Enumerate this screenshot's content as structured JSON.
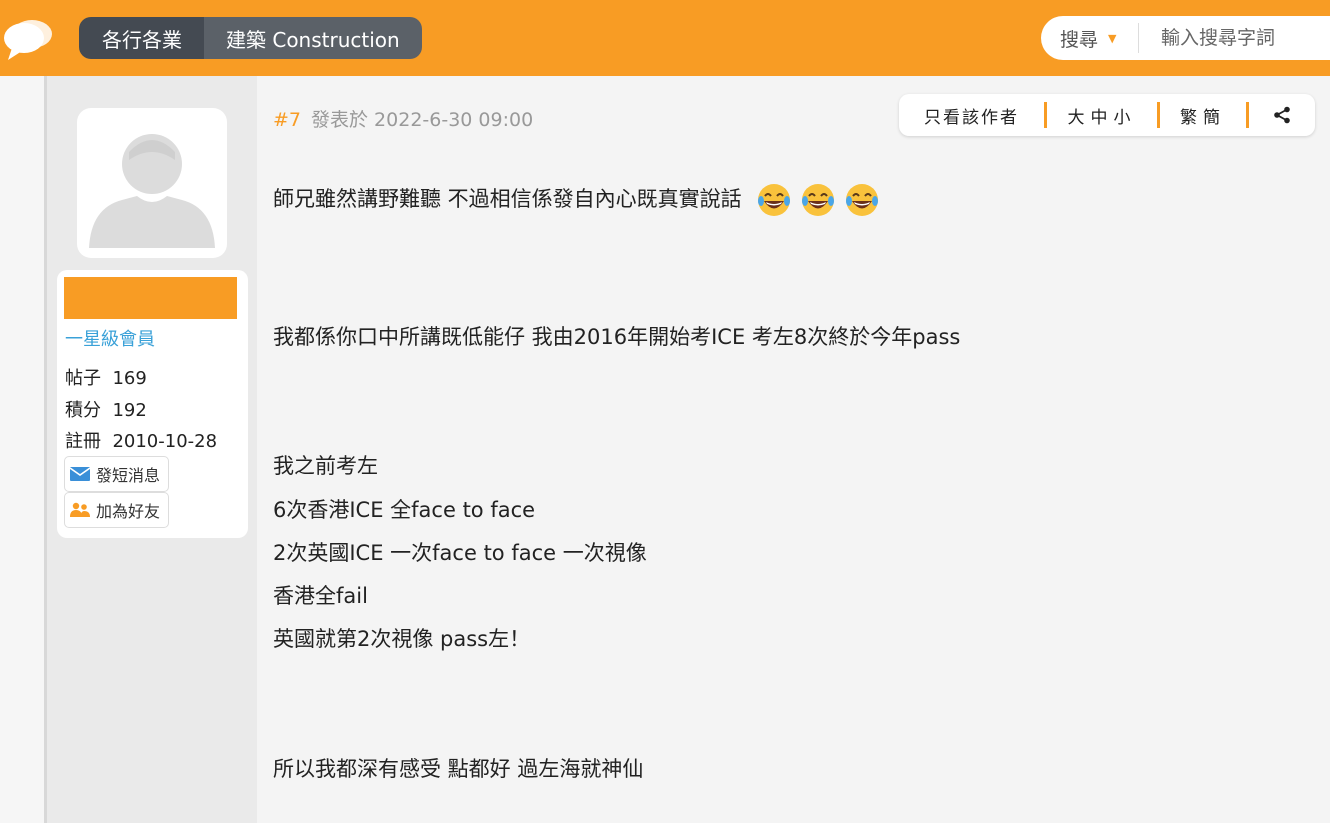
{
  "header": {
    "breadcrumbs": [
      "各行各業",
      "建築 Construction"
    ],
    "search_type": "搜尋",
    "search_placeholder": "輸入搜尋字詞"
  },
  "author": {
    "rank": "一星級會員",
    "posts_label": "帖子",
    "posts_value": "169",
    "points_label": "積分",
    "points_value": "192",
    "register_label": "註冊",
    "register_value": "2010-10-28",
    "send_message_label": "發短消息",
    "add_friend_label": "加為好友"
  },
  "post": {
    "number": "#7",
    "posted_at": "發表於 2022-6-30 09:00",
    "toolbar": {
      "author_only": "只看該作者",
      "font_size": "大中小",
      "script": "繁簡",
      "share_icon": "share-icon"
    },
    "lines": [
      "師兄雖然講野難聽  不過相信係發自內心既真實說話",
      "我都係你口中所講既低能仔  我由2016年開始考ICE  考左8次終於今年pass",
      "我之前考左",
      "6次香港ICE  全face  to  face",
      "2次英國ICE  一次face  to  face  一次視像",
      "香港全fail",
      "英國就第2次視像  pass左！",
      "所以我都深有感受  點都好  過左海就神仙"
    ]
  },
  "colors": {
    "brand_orange": "#f89c24",
    "rank_blue": "#3aa1d8"
  }
}
